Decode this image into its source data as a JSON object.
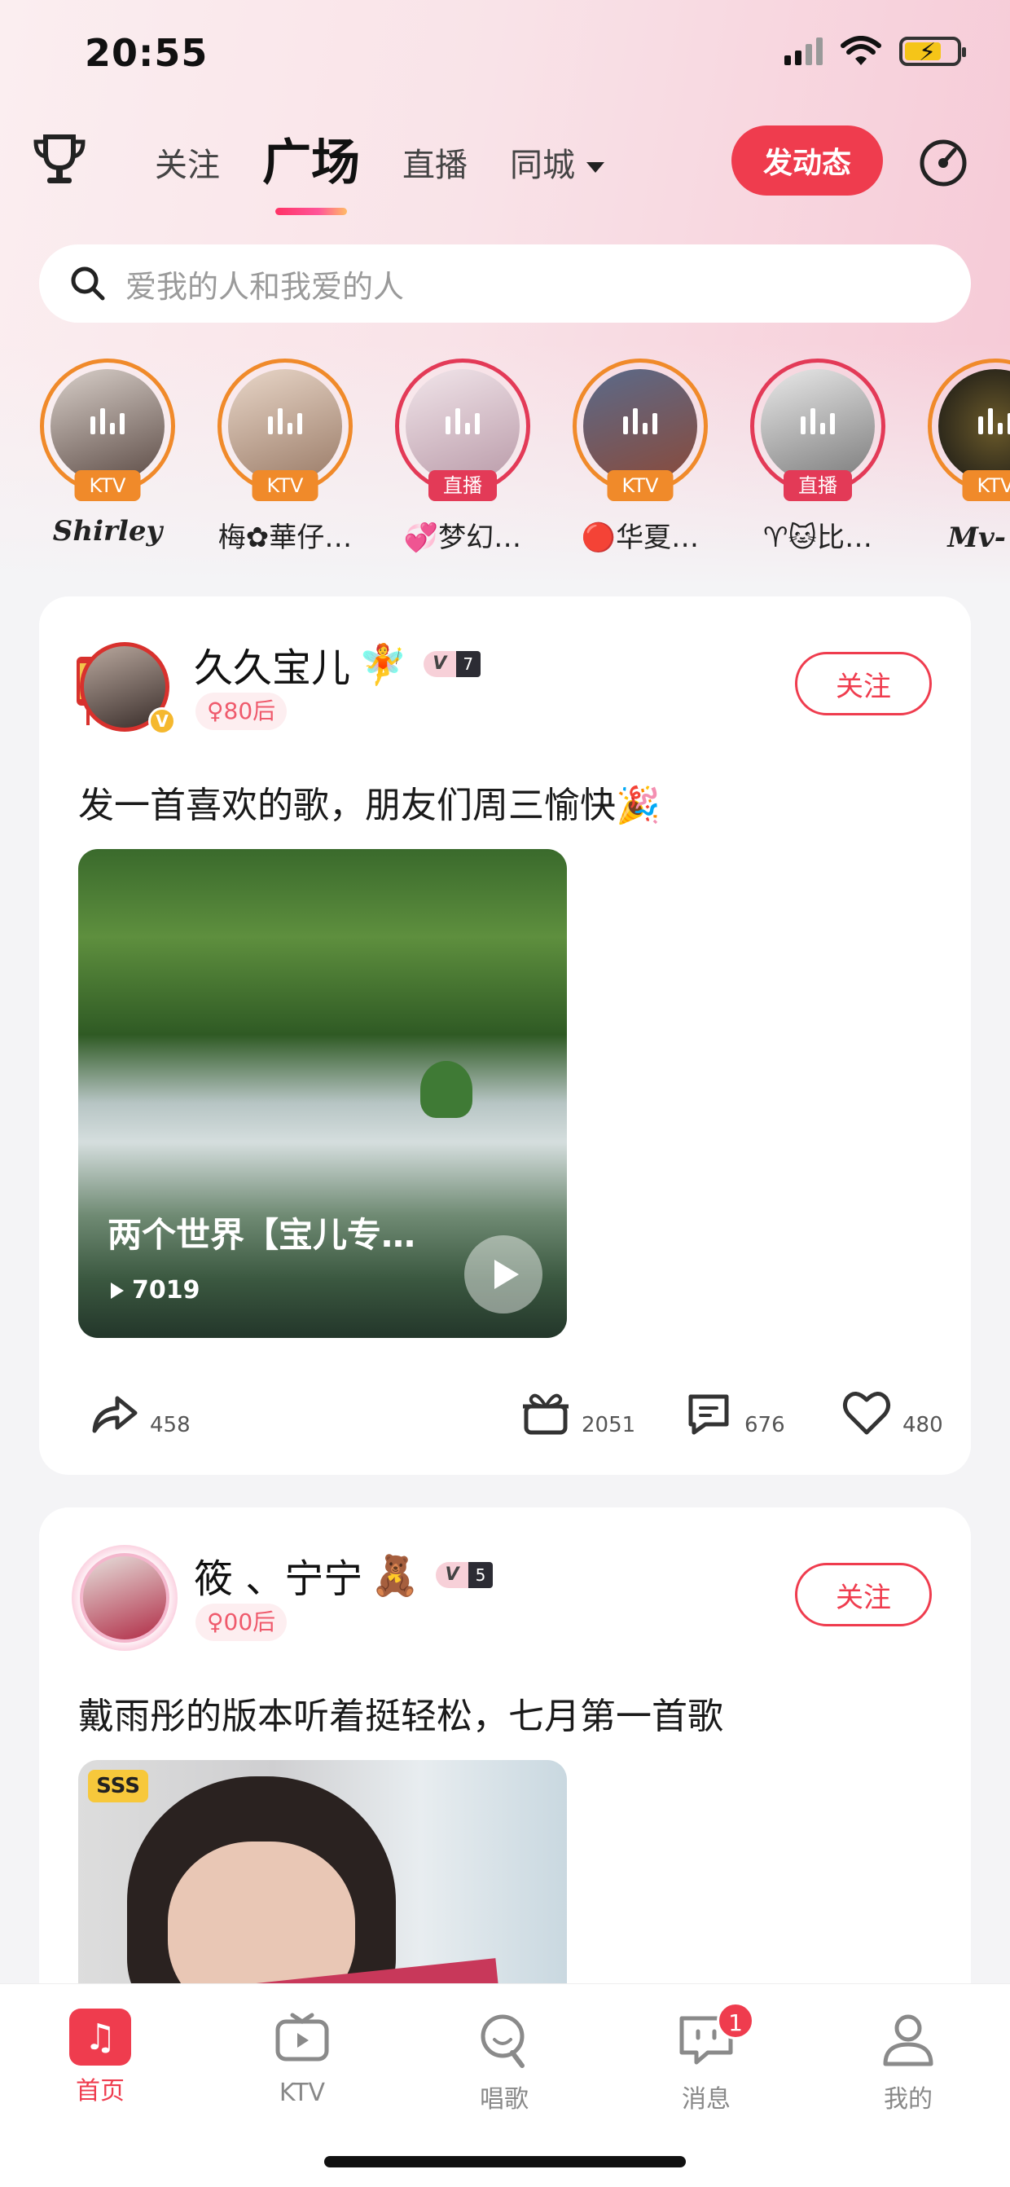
{
  "status_bar": {
    "time": "20:55"
  },
  "header": {
    "tabs": [
      {
        "label": "关注",
        "active": false
      },
      {
        "label": "广场",
        "active": true
      },
      {
        "label": "直播",
        "active": false
      },
      {
        "label": "同城",
        "active": false,
        "has_dropdown": true
      }
    ],
    "post_button": "发动态",
    "icons": [
      "trophy-icon",
      "radar-icon"
    ]
  },
  "search": {
    "placeholder": "爱我的人和我爱的人"
  },
  "stories": [
    {
      "name": "Shirley",
      "badge": "KTV",
      "type": "ktv"
    },
    {
      "name": "梅✿華仔…",
      "badge": "KTV",
      "type": "ktv"
    },
    {
      "name": "💞梦幻…",
      "badge": "直播",
      "type": "live"
    },
    {
      "name": "🔴华夏…",
      "badge": "KTV",
      "type": "ktv"
    },
    {
      "name": "♈🐱比…",
      "badge": "直播",
      "type": "live"
    },
    {
      "name": "Mv- 村",
      "badge": "KTV",
      "type": "ktv"
    }
  ],
  "posts": [
    {
      "username": "久久宝儿",
      "name_emoji": "🧚",
      "vip_level": "7",
      "age_tag": "♀80后",
      "follow_label": "关注",
      "text": "发一首喜欢的歌，朋友们周三愉快🎉",
      "video": {
        "title": "两个世界【宝儿专…",
        "plays": "7019"
      },
      "actions": {
        "share": "458",
        "gift": "2051",
        "comment": "676",
        "like": "480"
      }
    },
    {
      "username": "筱 、宁宁",
      "name_emoji": "🧸",
      "vip_level": "5",
      "age_tag": "♀00后",
      "follow_label": "关注",
      "text": "戴雨彤的版本听着挺轻松，七月第一首歌",
      "photo_tag": "SSS"
    }
  ],
  "bottom_nav": [
    {
      "label": "首页",
      "active": true
    },
    {
      "label": "KTV",
      "active": false
    },
    {
      "label": "唱歌",
      "active": false
    },
    {
      "label": "消息",
      "active": false,
      "badge": "1"
    },
    {
      "label": "我的",
      "active": false
    }
  ],
  "colors": {
    "accent": "#ef3c4e",
    "ktv": "#f08a2a",
    "live": "#e33a57"
  }
}
